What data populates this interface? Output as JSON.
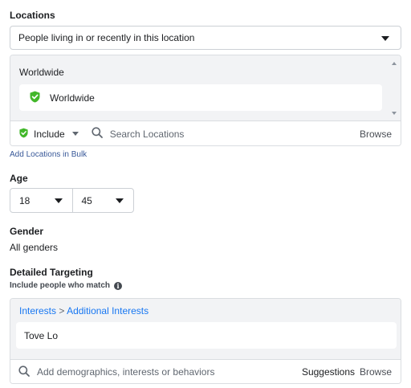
{
  "locations": {
    "title": "Locations",
    "type_select": "People living in or recently in this location",
    "group_title": "Worldwide",
    "selected": [
      {
        "name": "Worldwide",
        "icon": "check-shield-icon",
        "color": "#42b72a"
      }
    ],
    "include_label": "Include",
    "search_placeholder": "Search Locations",
    "browse_label": "Browse",
    "bulk_link": "Add Locations in Bulk"
  },
  "age": {
    "title": "Age",
    "min": "18",
    "max": "45"
  },
  "gender": {
    "title": "Gender",
    "value": "All genders"
  },
  "detailed_targeting": {
    "title": "Detailed Targeting",
    "subtitle": "Include people who match",
    "breadcrumb": {
      "part1": "Interests",
      "separator": ">",
      "part2": "Additional Interests"
    },
    "items": [
      "Tove Lo"
    ],
    "search_placeholder": "Add demographics, interests or behaviors",
    "suggestions_label": "Suggestions",
    "browse_label": "Browse"
  },
  "colors": {
    "link": "#385898",
    "accent": "#1877f2",
    "include_green": "#42b72a"
  }
}
